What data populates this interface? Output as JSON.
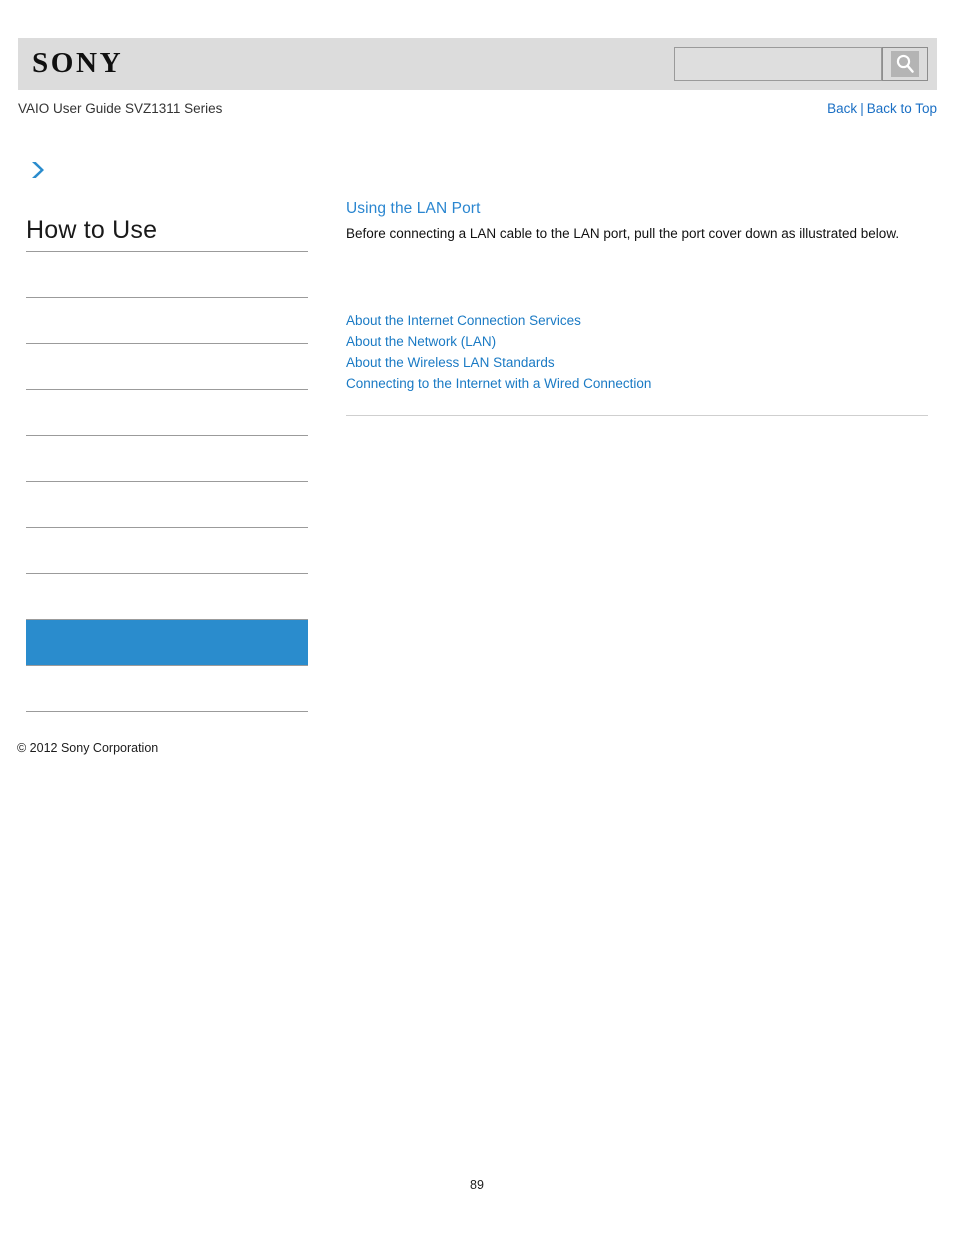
{
  "header": {
    "logo_text": "SONY",
    "search": {
      "value": "",
      "placeholder": "",
      "icon": "search-icon",
      "button_label": ""
    }
  },
  "breadcrumb": {
    "guide_title": "VAIO User Guide SVZ1311 Series",
    "back_label": "Back",
    "separator": "|",
    "back_to_top_label": "Back to Top"
  },
  "sidebar": {
    "chevron_icon": "chevron-right-icon",
    "heading": "How to Use",
    "accent_color": "#2a8ccd",
    "rule_color": "#9b9b9b",
    "items": [
      {
        "label": "",
        "selected": false
      },
      {
        "label": "",
        "selected": false
      },
      {
        "label": "",
        "selected": false
      },
      {
        "label": "",
        "selected": false
      },
      {
        "label": "",
        "selected": false
      },
      {
        "label": "",
        "selected": false
      },
      {
        "label": "",
        "selected": false
      },
      {
        "label": "",
        "selected": false
      },
      {
        "label": "",
        "selected": true
      },
      {
        "label": "",
        "selected": false
      }
    ]
  },
  "footer": {
    "copyright": "© 2012 Sony Corporation",
    "page_number": "89"
  },
  "main": {
    "title": "Using the LAN Port",
    "title_color": "#2a86d0",
    "description": "Before connecting a LAN cable to the LAN port, pull the port cover down as illustrated below.",
    "related_links": [
      "About the Internet Connection Services",
      "About the Network (LAN)",
      "About the Wireless LAN Standards",
      "Connecting to the Internet with a Wired Connection"
    ],
    "link_color": "#1a7ac4"
  }
}
